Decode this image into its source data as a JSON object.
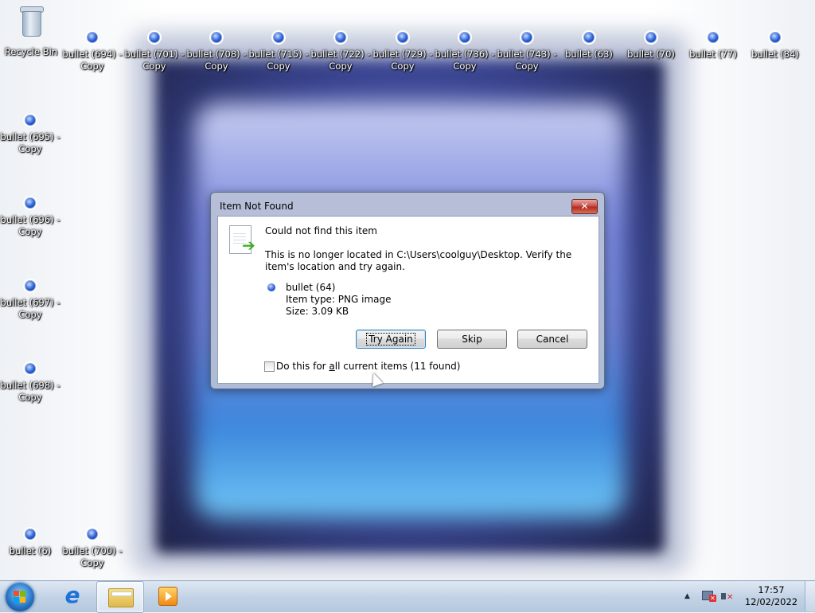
{
  "desktop": {
    "recycle_bin": "Recycle Bin",
    "top_row": [
      "bullet (694) -\nCopy",
      "bullet (701) -\nCopy",
      "bullet (708) -\nCopy",
      "bullet (715) -\nCopy",
      "bullet (722) -\nCopy",
      "bullet (729) -\nCopy",
      "bullet (736) -\nCopy",
      "bullet (743) -\nCopy",
      "bullet (63)",
      "bullet (70)",
      "bullet (77)",
      "bullet (84)"
    ],
    "left_column": [
      "bullet (695) -\nCopy",
      "bullet (696) -\nCopy",
      "bullet (697) -\nCopy",
      "bullet (698) -\nCopy"
    ],
    "bottom_row": [
      "bullet (6)",
      "bullet (700) -\nCopy"
    ]
  },
  "dialog": {
    "title": "Item Not Found",
    "close_glyph": "✕",
    "heading": "Could not find this item",
    "message": "This is no longer located in C:\\Users\\coolguy\\Desktop. Verify the item's location and try again.",
    "item": {
      "name": "bullet (64)",
      "type": "Item type: PNG image",
      "size": "Size: 3.09 KB"
    },
    "buttons": {
      "try_again": "Try Again",
      "skip": "Skip",
      "cancel": "Cancel"
    },
    "checkbox": {
      "checked": false,
      "label_prefix": "Do this for ",
      "label_underlined": "a",
      "label_suffix": "ll current items (11 found)"
    }
  },
  "taskbar": {
    "pinned": [
      "internet-explorer-icon",
      "windows-explorer-icon",
      "media-player-icon"
    ],
    "tray": {
      "time": "17:57",
      "date": "12/02/2022"
    }
  },
  "colors": {
    "close_button": "#c75050",
    "taskbar": "#c3d3e6",
    "default_button_border": "#3c7fb1"
  }
}
